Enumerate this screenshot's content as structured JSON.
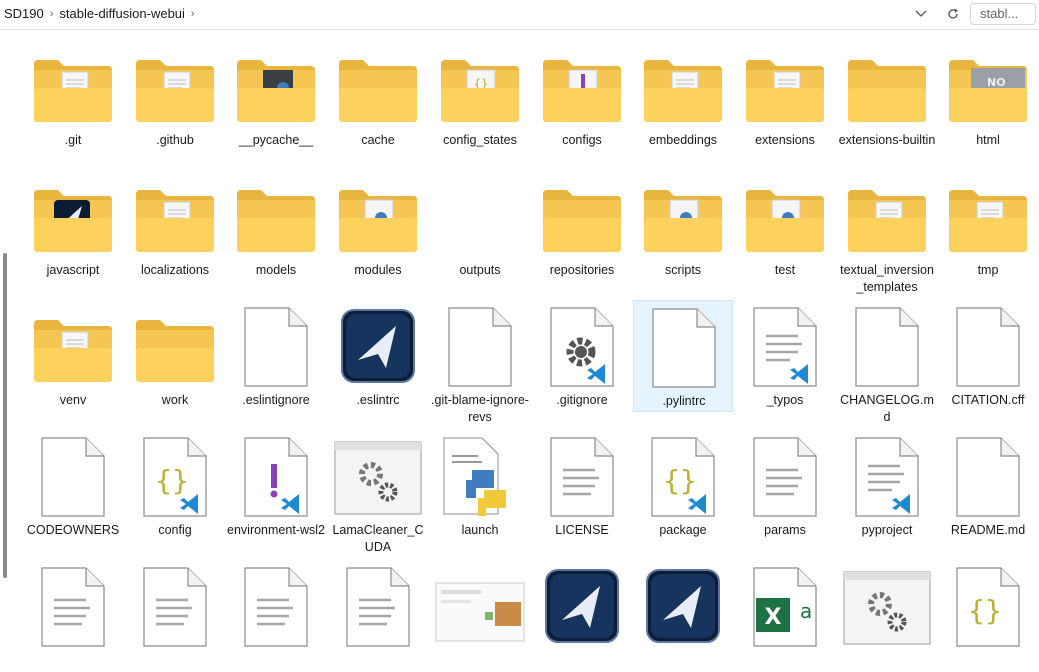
{
  "address": {
    "path": [
      {
        "label": "SD190"
      },
      {
        "label": "stable-diffusion-webui"
      }
    ],
    "search_value": "stabl..."
  },
  "icons": {
    "dropdown": "chevron-down-icon",
    "refresh": "refresh-icon",
    "chevron": "chevron-right-icon"
  },
  "rows": [
    [
      {
        "name": ".git",
        "kind": "folder",
        "preview": "paper"
      },
      {
        "name": ".github",
        "kind": "folder",
        "preview": "paper"
      },
      {
        "name": "__pycache__",
        "kind": "folder",
        "preview": "dark"
      },
      {
        "name": "cache",
        "kind": "folder",
        "preview": "none"
      },
      {
        "name": "config_states",
        "kind": "folder",
        "preview": "json"
      },
      {
        "name": "configs",
        "kind": "folder",
        "preview": "purple"
      },
      {
        "name": "embeddings",
        "kind": "folder",
        "preview": "paper"
      },
      {
        "name": "extensions",
        "kind": "folder",
        "preview": "paper"
      },
      {
        "name": "extensions-builtin",
        "kind": "folder",
        "preview": "none"
      },
      {
        "name": "html",
        "kind": "folder",
        "preview": "gray"
      }
    ],
    [
      {
        "name": "javascript",
        "kind": "folder",
        "preview": "nav"
      },
      {
        "name": "localizations",
        "kind": "folder",
        "preview": "paper"
      },
      {
        "name": "models",
        "kind": "folder",
        "preview": "none"
      },
      {
        "name": "modules",
        "kind": "folder",
        "preview": "python"
      },
      {
        "name": "outputs",
        "kind": "empty",
        "preview": "none"
      },
      {
        "name": "repositories",
        "kind": "folder",
        "preview": "none"
      },
      {
        "name": "scripts",
        "kind": "folder",
        "preview": "python"
      },
      {
        "name": "test",
        "kind": "folder",
        "preview": "python"
      },
      {
        "name": "textual_inversion_templates",
        "kind": "folder",
        "preview": "paper"
      },
      {
        "name": "tmp",
        "kind": "folder",
        "preview": "paper"
      }
    ],
    [
      {
        "name": "venv",
        "kind": "folder",
        "preview": "paper"
      },
      {
        "name": "work",
        "kind": "folder",
        "preview": "none"
      },
      {
        "name": ".eslintignore",
        "kind": "blank"
      },
      {
        "name": ".eslintrc",
        "kind": "navapp"
      },
      {
        "name": ".git-blame-ignore-revs",
        "kind": "blank"
      },
      {
        "name": ".gitignore",
        "kind": "gear-vscode"
      },
      {
        "name": ".pylintrc",
        "kind": "blank",
        "selected": true
      },
      {
        "name": "_typos",
        "kind": "lines-vscode"
      },
      {
        "name": "CHANGELOG.md",
        "kind": "blank"
      },
      {
        "name": "CITATION.cff",
        "kind": "blank"
      }
    ],
    [
      {
        "name": "CODEOWNERS",
        "kind": "blank"
      },
      {
        "name": "config",
        "kind": "braces-vscode"
      },
      {
        "name": "environment-wsl2",
        "kind": "excl-vscode"
      },
      {
        "name": "LamaCleaner_CUDA",
        "kind": "gears-window"
      },
      {
        "name": "launch",
        "kind": "python-file"
      },
      {
        "name": "LICENSE",
        "kind": "lines"
      },
      {
        "name": "package",
        "kind": "braces-vscode"
      },
      {
        "name": "params",
        "kind": "lines"
      },
      {
        "name": "pyproject",
        "kind": "lines-vscode"
      },
      {
        "name": "README.md",
        "kind": "blank"
      }
    ],
    [
      {
        "name": "",
        "kind": "lines"
      },
      {
        "name": "",
        "kind": "lines"
      },
      {
        "name": "",
        "kind": "lines"
      },
      {
        "name": "",
        "kind": "lines"
      },
      {
        "name": "",
        "kind": "screenshot"
      },
      {
        "name": "",
        "kind": "navapp"
      },
      {
        "name": "",
        "kind": "navapp"
      },
      {
        "name": "",
        "kind": "excel"
      },
      {
        "name": "",
        "kind": "gears-window"
      },
      {
        "name": "",
        "kind": "braces"
      }
    ]
  ]
}
